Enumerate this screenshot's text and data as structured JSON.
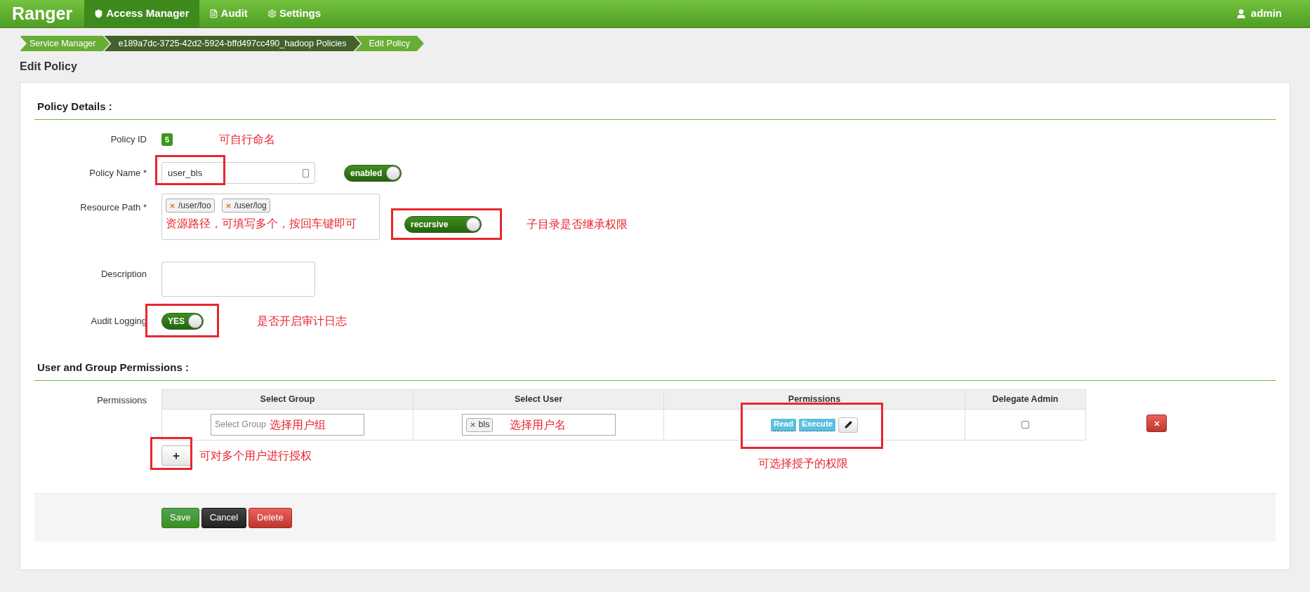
{
  "navbar": {
    "brand": "Ranger",
    "tabs": [
      {
        "label": "Access Manager",
        "kind": "shield",
        "selected": true
      },
      {
        "label": "Audit",
        "kind": "file",
        "selected": false
      },
      {
        "label": "Settings",
        "kind": "gear",
        "selected": false
      }
    ],
    "user": "admin"
  },
  "breadcrumb": [
    {
      "label": "Service Manager",
      "selected": false
    },
    {
      "label": "e189a7dc-3725-42d2-5924-bffd497cc490_hadoop Policies",
      "selected": true
    },
    {
      "label": "Edit Policy",
      "selected": false
    }
  ],
  "page_title": "Edit Policy",
  "policy_details": {
    "heading": "Policy Details :",
    "policy_id": {
      "label": "Policy ID",
      "value": "5",
      "note": "可自行命名"
    },
    "policy_name": {
      "label": "Policy Name *",
      "value": "user_bls",
      "annotation_box": true,
      "toggle": {
        "label": "enabled",
        "on": true
      }
    },
    "resource_path": {
      "label": "Resource Path *",
      "tags": [
        "/user/foo",
        "/user/log"
      ],
      "note": "资源路径，可填写多个，按回车键即可",
      "toggle": {
        "label": "recursive",
        "on": true,
        "annotation_box": true
      },
      "toggle_note": "子目录是否继承权限"
    },
    "description": {
      "label": "Description"
    },
    "audit_logging": {
      "label": "Audit Logging",
      "toggle": {
        "label": "YES",
        "on": true,
        "annotation_box": true
      },
      "note": "是否开启审计日志"
    }
  },
  "permissions_section": {
    "heading": "User and Group Permissions :",
    "label": "Permissions",
    "columns": [
      "Select Group",
      "Select User",
      "Permissions",
      "Delegate Admin"
    ],
    "rows": [
      {
        "group_placeholder": "Select Group",
        "group_note": "选择用户组",
        "users": [
          "bls"
        ],
        "user_note": "选择用户名",
        "permissions": [
          "Read",
          "Execute"
        ],
        "permissions_box": true,
        "delegate_admin": false
      }
    ],
    "add_box": true,
    "add_note": "可对多个用户进行授权",
    "permissions_note": "可选择授予的权限"
  },
  "buttons": [
    {
      "label": "Save",
      "kind": "success"
    },
    {
      "label": "Cancel",
      "kind": "dark"
    },
    {
      "label": "Delete",
      "kind": "danger"
    }
  ]
}
